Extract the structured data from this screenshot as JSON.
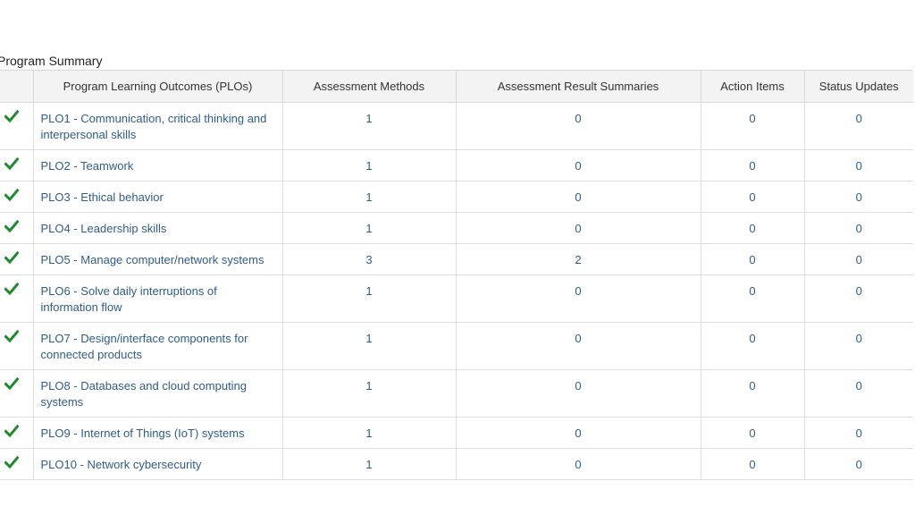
{
  "section_title": "Program Summary",
  "columns": {
    "check": "",
    "plo": "Program Learning Outcomes (PLOs)",
    "methods": "Assessment Methods",
    "results": "Assessment Result Summaries",
    "actions": "Action Items",
    "status": "Status Updates"
  },
  "colors": {
    "check": "#1e8a2e",
    "link": "#2f5c8a",
    "header_bg": "#f3f3f3"
  },
  "rows": [
    {
      "status_icon": "checkmark-icon",
      "plo": "PLO1 - Communication, critical thinking and interpersonal skills",
      "methods": "1",
      "results": "0",
      "actions": "0",
      "status": "0"
    },
    {
      "status_icon": "checkmark-icon",
      "plo": "PLO2 - Teamwork",
      "methods": "1",
      "results": "0",
      "actions": "0",
      "status": "0"
    },
    {
      "status_icon": "checkmark-icon",
      "plo": "PLO3 - Ethical behavior",
      "methods": "1",
      "results": "0",
      "actions": "0",
      "status": "0"
    },
    {
      "status_icon": "checkmark-icon",
      "plo": "PLO4 - Leadership skills",
      "methods": "1",
      "results": "0",
      "actions": "0",
      "status": "0"
    },
    {
      "status_icon": "checkmark-icon",
      "plo": "PLO5 - Manage computer/network systems",
      "methods": "3",
      "results": "2",
      "actions": "0",
      "status": "0"
    },
    {
      "status_icon": "checkmark-icon",
      "plo": "PLO6 - Solve daily interruptions of information flow",
      "methods": "1",
      "results": "0",
      "actions": "0",
      "status": "0"
    },
    {
      "status_icon": "checkmark-icon",
      "plo": "PLO7 - Design/interface components for connected products",
      "methods": "1",
      "results": "0",
      "actions": "0",
      "status": "0"
    },
    {
      "status_icon": "checkmark-icon",
      "plo": "PLO8 - Databases and cloud computing systems",
      "methods": "1",
      "results": "0",
      "actions": "0",
      "status": "0"
    },
    {
      "status_icon": "checkmark-icon",
      "plo": "PLO9 - Internet of Things (IoT) systems",
      "methods": "1",
      "results": "0",
      "actions": "0",
      "status": "0"
    },
    {
      "status_icon": "checkmark-icon",
      "plo": "PLO10 - Network cybersecurity",
      "methods": "1",
      "results": "0",
      "actions": "0",
      "status": "0"
    }
  ]
}
